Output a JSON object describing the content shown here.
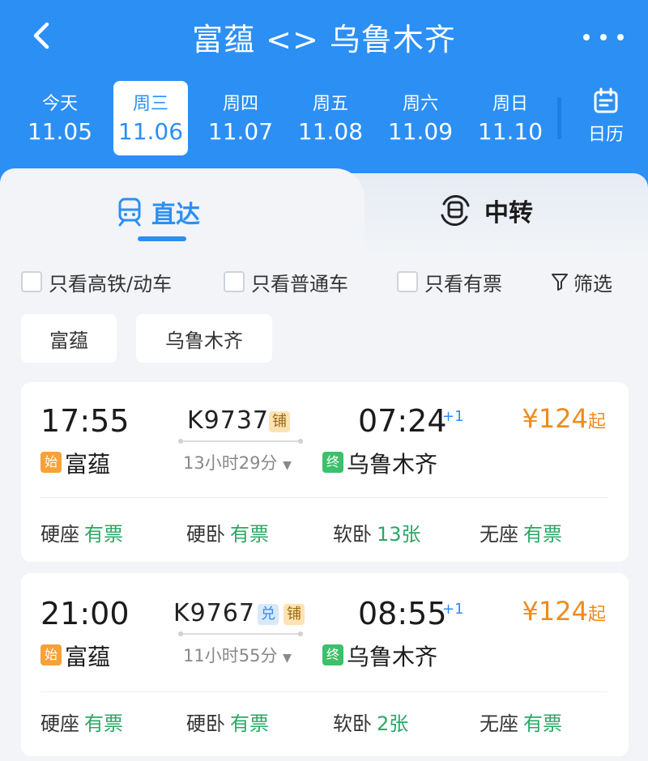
{
  "header": {
    "title": "富蕴 <> 乌鲁木齐",
    "dates": [
      {
        "weekday": "今天",
        "date": "11.05",
        "active": false
      },
      {
        "weekday": "周三",
        "date": "11.06",
        "active": true
      },
      {
        "weekday": "周四",
        "date": "11.07",
        "active": false
      },
      {
        "weekday": "周五",
        "date": "11.08",
        "active": false
      },
      {
        "weekday": "周六",
        "date": "11.09",
        "active": false
      },
      {
        "weekday": "周日",
        "date": "11.10",
        "active": false
      }
    ],
    "calendar_label": "日历"
  },
  "tabs": {
    "direct": "直达",
    "transfer": "中转"
  },
  "filters": {
    "high_speed": "只看高铁/动车",
    "regular": "只看普通车",
    "available": "只看有票",
    "filter": "筛选"
  },
  "stations": {
    "from": "富蕴",
    "to": "乌鲁木齐"
  },
  "trains": [
    {
      "dep_time": "17:55",
      "train_no": "K9737",
      "badges": [
        "铺"
      ],
      "arr_time": "07:24",
      "day_offset": "+1",
      "duration": "13小时29分",
      "price": "¥124",
      "price_suffix": "起",
      "start_tag": "始",
      "end_tag": "终",
      "from": "富蕴",
      "to": "乌鲁木齐",
      "seats": [
        {
          "type": "硬座",
          "status": "有票"
        },
        {
          "type": "硬卧",
          "status": "有票"
        },
        {
          "type": "软卧",
          "status": "13张"
        },
        {
          "type": "无座",
          "status": "有票"
        }
      ]
    },
    {
      "dep_time": "21:00",
      "train_no": "K9767",
      "badges": [
        "兑",
        "铺"
      ],
      "arr_time": "08:55",
      "day_offset": "+1",
      "duration": "11小时55分",
      "price": "¥124",
      "price_suffix": "起",
      "start_tag": "始",
      "end_tag": "终",
      "from": "富蕴",
      "to": "乌鲁木齐",
      "seats": [
        {
          "type": "硬座",
          "status": "有票"
        },
        {
          "type": "硬卧",
          "status": "有票"
        },
        {
          "type": "软卧",
          "status": "2张"
        },
        {
          "type": "无座",
          "status": "有票"
        }
      ]
    }
  ]
}
